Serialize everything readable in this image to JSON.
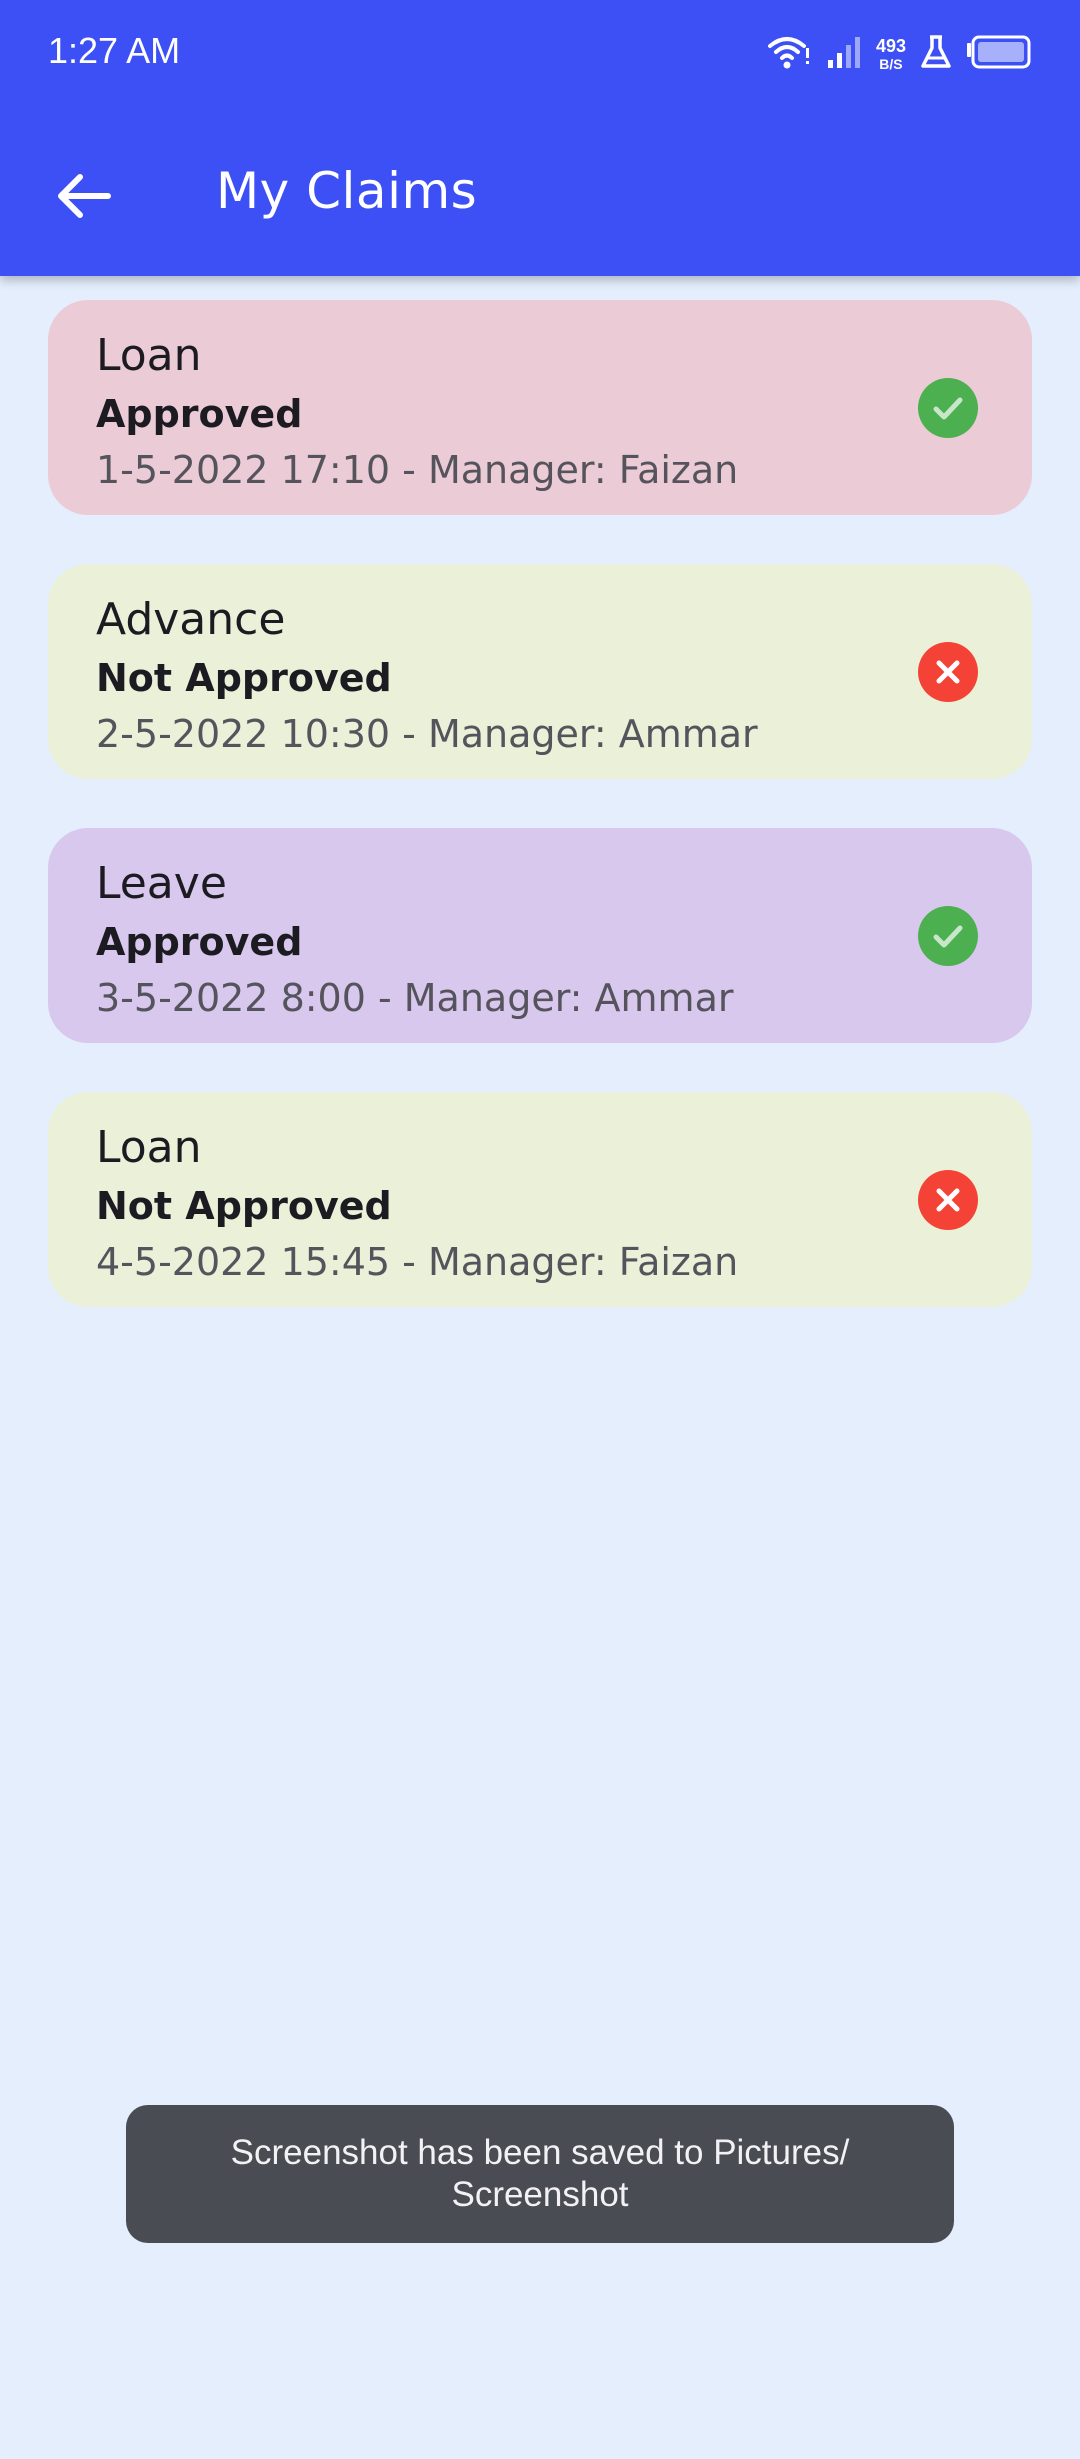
{
  "status_bar": {
    "time": "1:27 AM",
    "net_speed_value": "493",
    "net_speed_unit": "B/S",
    "icons": [
      "wifi-icon",
      "signal-icon",
      "flask-icon",
      "battery-icon"
    ]
  },
  "header": {
    "title": "My Claims",
    "back_icon": "arrow-left-icon"
  },
  "claims": [
    {
      "type": "Loan",
      "status": "Approved",
      "meta": "1-5-2022 17:10 - Manager: Faizan",
      "icon": "check-circle-icon",
      "card_color": "#ebcbd5",
      "icon_color": "#4caf50"
    },
    {
      "type": "Advance",
      "status": "Not Approved",
      "meta": "2-5-2022 10:30 - Manager: Ammar",
      "icon": "cancel-circle-icon",
      "card_color": "#ebf0d8",
      "icon_color": "#f44336"
    },
    {
      "type": "Leave",
      "status": "Approved",
      "meta": "3-5-2022 8:00 - Manager: Ammar",
      "icon": "check-circle-icon",
      "card_color": "#d8c8ee",
      "icon_color": "#4caf50"
    },
    {
      "type": "Loan",
      "status": "Not Approved",
      "meta": "4-5-2022 15:45 - Manager: Faizan",
      "icon": "cancel-circle-icon",
      "card_color": "#ebf0d8",
      "icon_color": "#f44336"
    }
  ],
  "toast": {
    "line1": "Screenshot has been saved to  Pictures/",
    "line2": "Screenshot"
  },
  "colors": {
    "app_bar": "#3d50f5",
    "background": "#e4eefd",
    "toast_bg": "#4a4c54"
  }
}
